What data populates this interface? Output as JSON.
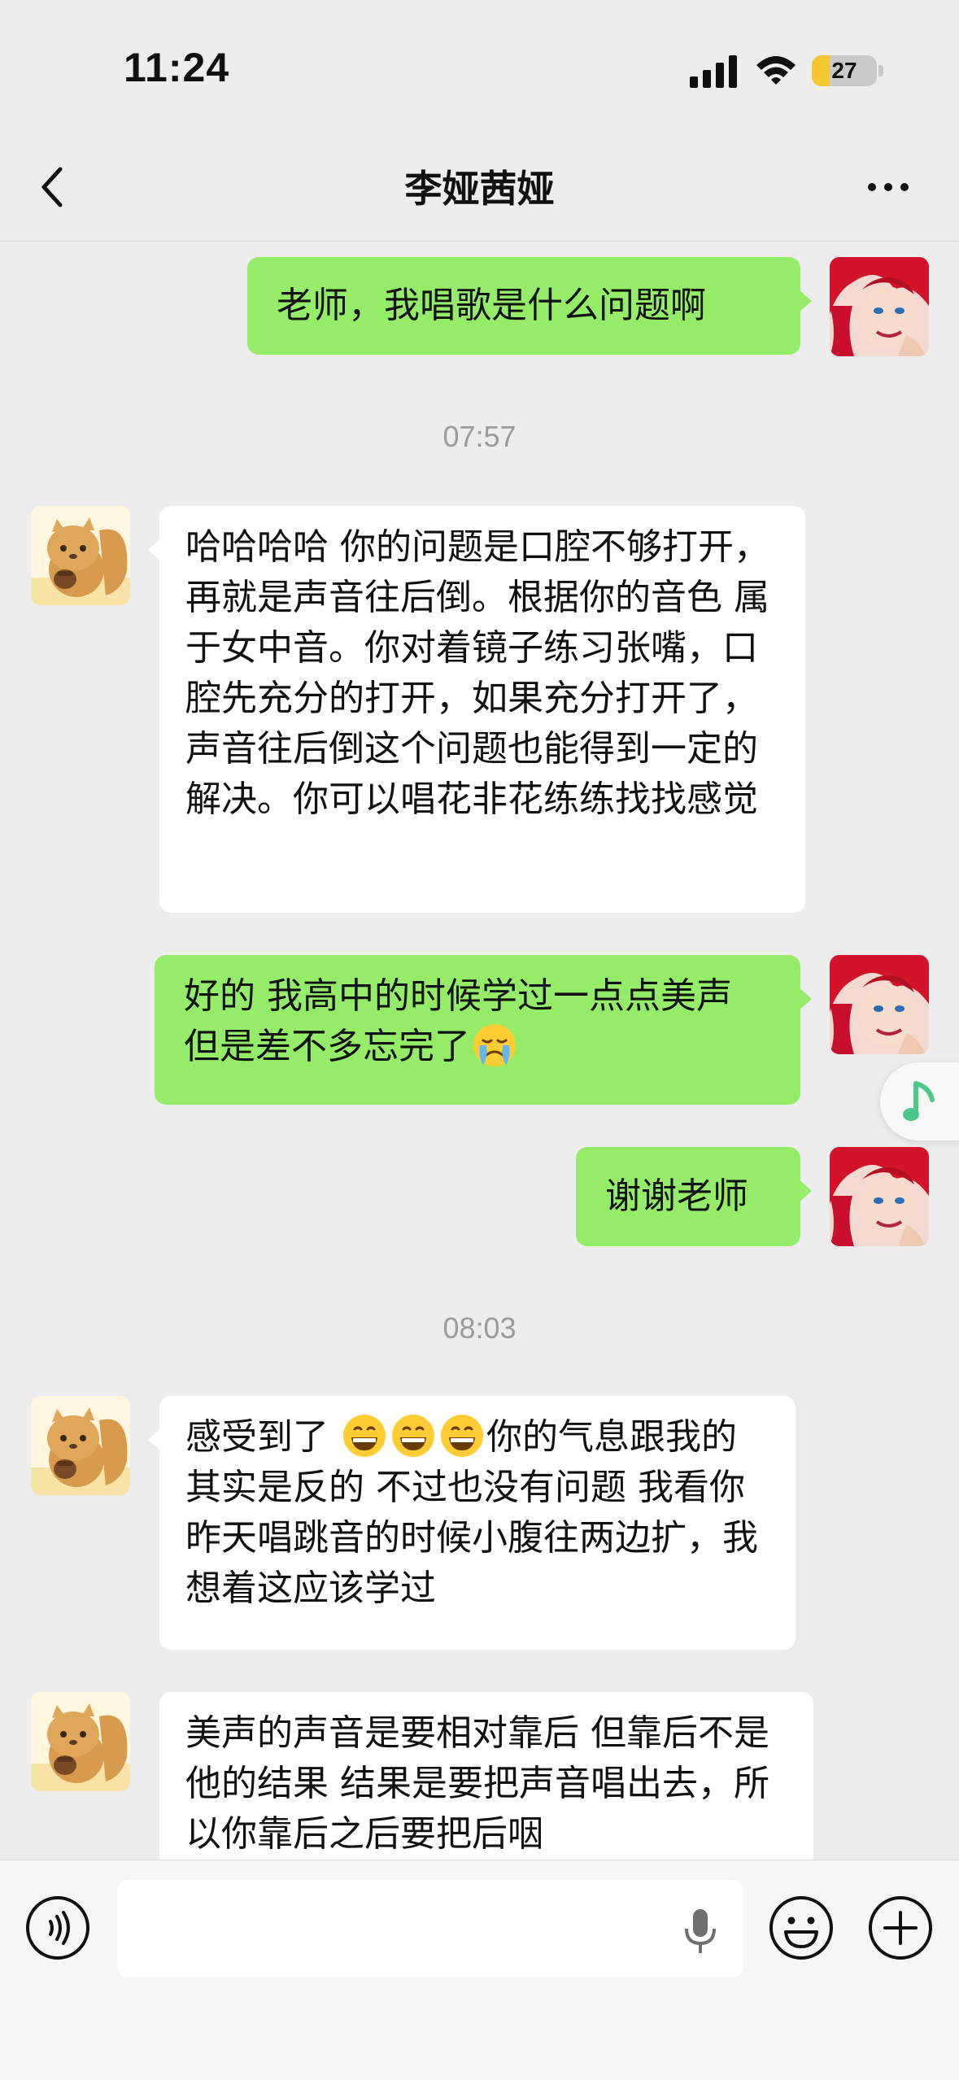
{
  "status_bar": {
    "time": "11:24",
    "battery": "27",
    "battery_level": 0.27
  },
  "nav": {
    "title": "李娅茜娅",
    "back_icon": "chevron-left-icon",
    "more_icon": "ellipsis-icon"
  },
  "messages": [
    {
      "side": "right",
      "text": "老师，我唱歌是什么问题啊"
    },
    {
      "type": "timestamp",
      "text": "07:57"
    },
    {
      "side": "left",
      "text": "哈哈哈哈 你的问题是口腔不够打开，再就是声音往后倒。根据你的音色 属于女中音。你对着镜子练习张嘴，口腔先充分的打开，如果充分打开了，声音往后倒这个问题也能得到一定的解决。你可以唱花非花练练找找感觉"
    },
    {
      "side": "right",
      "text_before": "好的 我高中的时候学过一点点美声 但是差不多忘完了",
      "emoji": "crying-face-icon"
    },
    {
      "side": "right",
      "text": "谢谢老师"
    },
    {
      "type": "timestamp",
      "text": "08:03"
    },
    {
      "side": "left",
      "text_before": "感受到了 ",
      "emojis": [
        "grinning-face-icon",
        "grinning-face-icon",
        "grinning-face-icon"
      ],
      "text_after": "你的气息跟我的其实是反的 不过也没有问题 我看你昨天唱跳音的时候小腹往两边扩，我想着这应该学过"
    },
    {
      "side": "left",
      "text": "美声的声音是要相对靠后 但靠后不是他的结果 结果是要把声音唱出去，所以你靠后之后要把后咽"
    }
  ],
  "floating": {
    "icon": "music-note-icon"
  },
  "input_bar": {
    "placeholder": "",
    "voice_icon": "voice-input-icon",
    "mic_icon": "microphone-icon",
    "emoji_icon": "smiley-icon",
    "plus_icon": "plus-circle-icon"
  },
  "colors": {
    "background": "#ededed",
    "bubble_mine": "#95ec69",
    "bubble_other": "#ffffff",
    "accent_music": "#4ac98a"
  }
}
